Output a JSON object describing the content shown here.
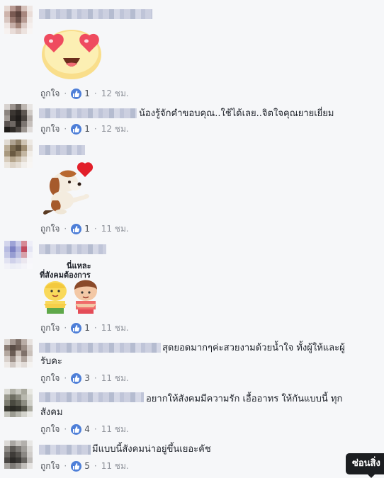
{
  "colors": {
    "like_blue": "#4e7fd8",
    "link": "#616770",
    "text": "#1d2129",
    "background": "#f6f7f9"
  },
  "comments": [
    {
      "text": "",
      "like_label": "ถูกใจ",
      "likes": "1",
      "time": "12 ชม.",
      "sticker": "heart-eyes-emoji-sticker"
    },
    {
      "text": "น้องรู้จักคำขอบคุณ..ใช้ได้เลย..จิตใจคุณยายเยี่ยม",
      "like_label": "ถูกใจ",
      "likes": "1",
      "time": "12 ชม."
    },
    {
      "text": "",
      "like_label": "ถูกใจ",
      "likes": "1",
      "time": "11 ชม.",
      "sticker": "puppy-heart-sticker"
    },
    {
      "text": "",
      "like_label": "ถูกใจ",
      "likes": "1",
      "time": "11 ชม.",
      "sticker": "two-kids-sticker",
      "sticker_text": [
        "นี่แหละ",
        "ที่สังคมต้องการ"
      ]
    },
    {
      "text_line1": "สุดยอดมากๆค่ะสวยงามด้วยน้ำใจ ทั้งผู้ให้และผู้",
      "text_line2": "รับคะ",
      "like_label": "ถูกใจ",
      "likes": "3",
      "time": "11 ชม."
    },
    {
      "text_line1": "อยากให้สังคมมีความรัก เอื้ออาทร ให้กันแบบนี้ ทุก",
      "text_line2": "สังคม",
      "like_label": "ถูกใจ",
      "likes": "4",
      "time": "11 ชม."
    },
    {
      "text": "มีแบบนี้สังคมน่าอยู่ขึ้นเยอะคัช",
      "like_label": "ถูกใจ",
      "likes": "5",
      "time": "11 ชม."
    }
  ],
  "tooltip": {
    "label": "ซ่อนสิ่ง"
  }
}
